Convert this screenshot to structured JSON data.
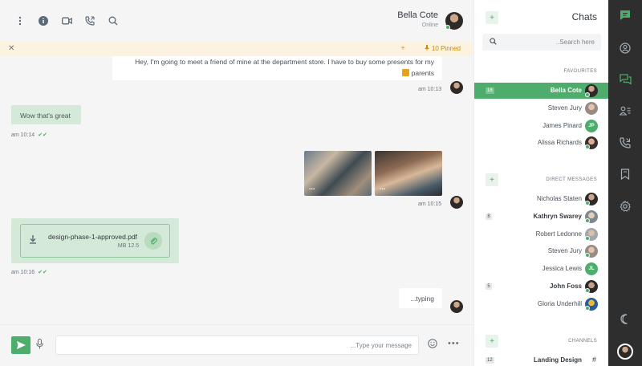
{
  "header": {
    "contact_name": "Bella Cote",
    "contact_status": "Online",
    "icons": [
      "more-vertical-icon",
      "info-icon",
      "video-icon",
      "phone-icon",
      "search-icon"
    ]
  },
  "pinned": {
    "count_label": "10 Pinned",
    "close_symbol": "✕",
    "plus_symbol": "+"
  },
  "messages": {
    "m1_text": "Hey, I'm going to meet a friend of mine at the department store. I have to buy some presents for my",
    "m1_text2": "parents",
    "m1_time": "am 10:13",
    "m2_text": "Wow that's great",
    "m2_time": "am 10:14",
    "photos_more": "...",
    "m3_time": "am 10:15",
    "file_name": "design-phase-1-approved.pdf",
    "file_size": "MB 12.5",
    "m4_time": "am 10:16",
    "typing": "...typing",
    "tick": "✔✔"
  },
  "composer": {
    "placeholder": "...Type your message",
    "more": "•••"
  },
  "sidebar": {
    "title": "Chats",
    "search_placeholder": "..Search here",
    "favourites_title": "FAVOURITES",
    "direct_title": "DIRECT MESSAGES",
    "channels_title": "CHANNELS",
    "favourites": [
      {
        "name": "Bella Cote",
        "badge": "18",
        "active": true
      },
      {
        "name": "Steven Jury"
      },
      {
        "name": "James Pinard",
        "initials": "JP"
      },
      {
        "name": "Alissa Richards"
      }
    ],
    "direct": [
      {
        "name": "Nicholas Staten"
      },
      {
        "name": "Kathryn Swarey",
        "badge": "8"
      },
      {
        "name": "Robert Ledonne"
      },
      {
        "name": "Steven Jury"
      },
      {
        "name": "Jessica Lewis",
        "initials": "JL"
      },
      {
        "name": "John Foss",
        "badge": "5"
      },
      {
        "name": "Gloria Underhill"
      }
    ],
    "channels": [
      {
        "name": "Landing Design",
        "badge": "12",
        "hash": "#"
      }
    ]
  },
  "colors": {
    "accent": "#4eac6d",
    "rail": "#2e2e2e",
    "pinned_bg": "#fbf3df",
    "bubble_green": "#d4e9d8"
  }
}
